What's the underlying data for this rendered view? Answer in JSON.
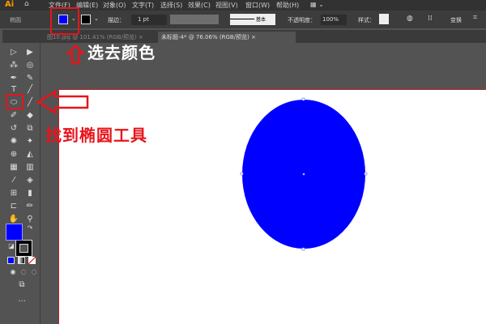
{
  "app": {
    "logo": "Ai",
    "home_icon": "home-icon"
  },
  "menu": [
    "文件(F)",
    "编辑(E)",
    "对象(O)",
    "文字(T)",
    "选择(S)",
    "效果(C)",
    "视图(V)",
    "窗口(W)",
    "帮助(H)"
  ],
  "control": {
    "object_type": "椭圆",
    "fill_color": "#0000ff",
    "stroke_label": "描边：",
    "stroke_value": "1 pt",
    "brush_label": "基本",
    "opacity_label": "不透明度：",
    "opacity_value": "100%",
    "style_label": "样式：",
    "transform_label": "变换"
  },
  "tabs": [
    {
      "label": "图10.jpg @ 101.41% (RGB/预览)"
    },
    {
      "label": "未标题-4* @ 76.06% (RGB/预览)"
    }
  ],
  "tools": {
    "fill": "#0000ff",
    "stroke": "#000000",
    "colors": {
      "accent": "#e8141b",
      "ellipse": "#0000ff"
    }
  },
  "annotations": {
    "pick_color": "选去颜色",
    "find_ellipse": "找到椭圆工具"
  }
}
